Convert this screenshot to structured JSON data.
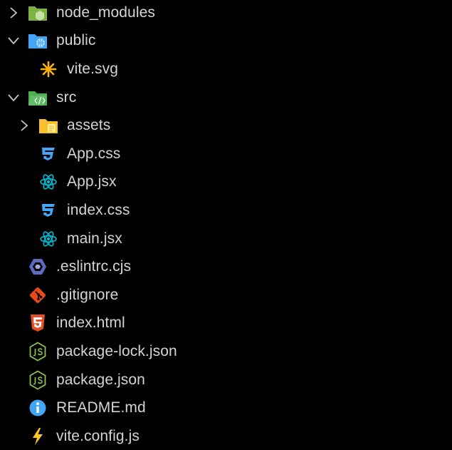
{
  "explorer": {
    "items": [
      {
        "label": "node_modules",
        "icon": "folder-node-icon",
        "type": "folder",
        "expanded": false
      },
      {
        "label": "public",
        "icon": "folder-public-icon",
        "type": "folder",
        "expanded": true
      },
      {
        "label": "vite.svg",
        "icon": "svg-file-icon",
        "type": "file"
      },
      {
        "label": "src",
        "icon": "folder-src-icon",
        "type": "folder",
        "expanded": true
      },
      {
        "label": "assets",
        "icon": "folder-assets-icon",
        "type": "folder",
        "expanded": false
      },
      {
        "label": "App.css",
        "icon": "css-file-icon",
        "type": "file"
      },
      {
        "label": "App.jsx",
        "icon": "react-file-icon",
        "type": "file"
      },
      {
        "label": "index.css",
        "icon": "css-file-icon",
        "type": "file"
      },
      {
        "label": "main.jsx",
        "icon": "react-file-icon",
        "type": "file"
      },
      {
        "label": ".eslintrc.cjs",
        "icon": "eslint-file-icon",
        "type": "file"
      },
      {
        "label": ".gitignore",
        "icon": "git-file-icon",
        "type": "file"
      },
      {
        "label": "index.html",
        "icon": "html-file-icon",
        "type": "file"
      },
      {
        "label": "package-lock.json",
        "icon": "nodejs-file-icon",
        "type": "file"
      },
      {
        "label": "package.json",
        "icon": "nodejs-file-icon",
        "type": "file"
      },
      {
        "label": "README.md",
        "icon": "info-file-icon",
        "type": "file"
      },
      {
        "label": "vite.config.js",
        "icon": "vite-file-icon",
        "type": "file"
      }
    ]
  },
  "colors": {
    "background": "#000000",
    "text": "#d4d4d4",
    "chevron": "#c5c5c5",
    "folder_green": "#7cb342",
    "folder_blue": "#42a5f5",
    "folder_yellow": "#fbc02d",
    "css_blue": "#42a5f5",
    "react_cyan": "#00bcd4",
    "eslint_purple": "#3f51b5",
    "git_orange": "#e64a19",
    "html_orange": "#e44d26",
    "node_green": "#8bc34a",
    "info_blue": "#42a5f5",
    "vite_yellow": "#ffca28"
  }
}
